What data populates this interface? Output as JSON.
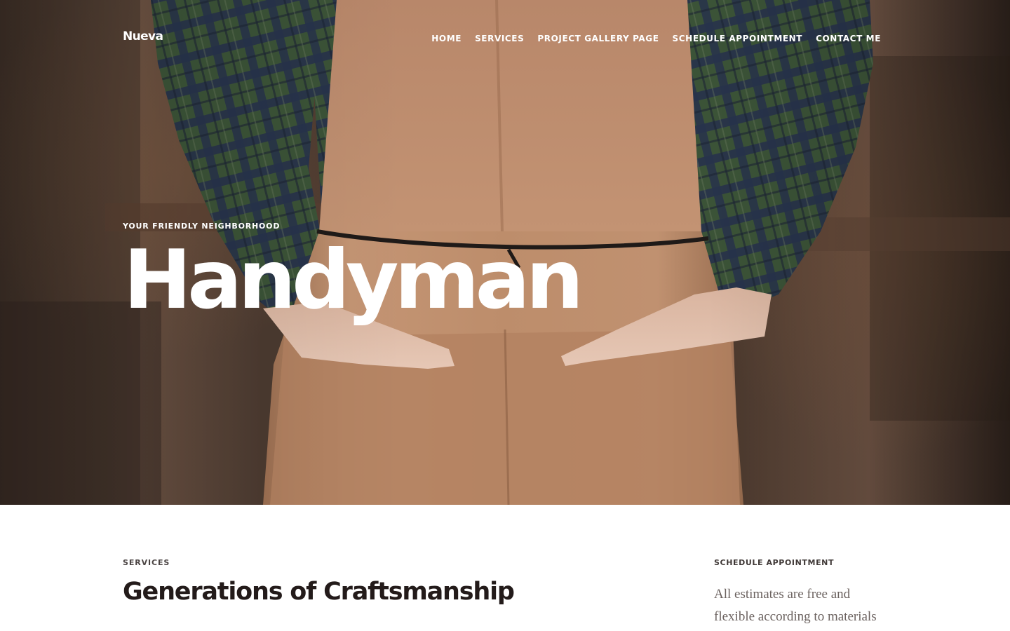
{
  "header": {
    "logo": "Nueva",
    "nav": [
      {
        "label": "HOME"
      },
      {
        "label": "SERVICES"
      },
      {
        "label": "PROJECT GALLERY PAGE"
      },
      {
        "label": "SCHEDULE APPOINTMENT"
      },
      {
        "label": "CONTACT ME"
      }
    ]
  },
  "hero": {
    "eyebrow": "YOUR FRIENDLY NEIGHBORHOOD",
    "title": "Handyman"
  },
  "services": {
    "eyebrow": "SERVICES",
    "title": "Generations of Craftsmanship"
  },
  "appointment": {
    "title": "SCHEDULE APPOINTMENT",
    "text": "All estimates are free and flexible according to materials"
  },
  "colors": {
    "hero_text": "#ffffff",
    "heading": "#231b1a",
    "body_text": "#6b625f",
    "apron": "#b98a67",
    "flannel_green": "#3b5337",
    "flannel_navy": "#2a3550"
  }
}
